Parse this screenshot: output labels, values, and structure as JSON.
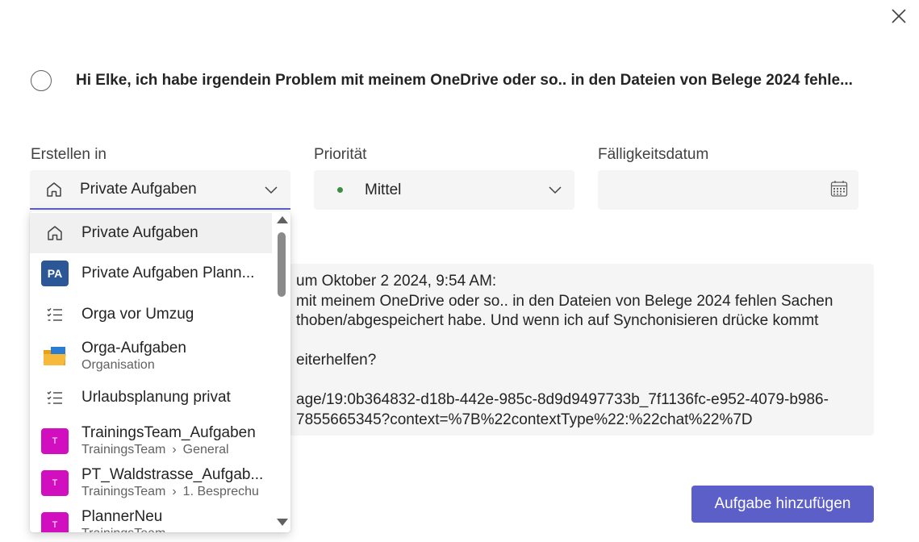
{
  "task": {
    "title": "Hi Elke, ich habe irgendein Problem mit meinem OneDrive oder so.. in den Dateien von Belege 2024 fehle..."
  },
  "fields": {
    "create_in": {
      "label": "Erstellen in",
      "value": "Private Aufgaben"
    },
    "priority": {
      "label": "Priorität",
      "value": "Mittel",
      "color": "#3a8f3e"
    },
    "due_date": {
      "label": "Fälligkeitsdatum",
      "value": ""
    }
  },
  "dropdown": {
    "items": [
      {
        "label": "Private Aufgaben",
        "icon": "home-icon",
        "selected": true
      },
      {
        "label": "Private Aufgaben Plann...",
        "icon": "plan-badge",
        "badge": "PA",
        "badge_color": "#2b5797"
      },
      {
        "label": "Orga vor Umzug",
        "icon": "checklist-icon"
      },
      {
        "label": "Orga-Aufgaben",
        "sub": "Organisation",
        "icon": "folder-icon"
      },
      {
        "label": "Urlaubsplanung privat",
        "icon": "checklist-icon"
      },
      {
        "label": "TrainingsTeam_Aufgaben",
        "sub": "TrainingsTeam",
        "sub2": "General",
        "icon": "team-badge",
        "badge": "T",
        "badge_color": "#d10fbe"
      },
      {
        "label": "PT_Waldstrasse_Aufgab...",
        "sub": "TrainingsTeam",
        "sub2": "1. Besprechu",
        "icon": "team-badge",
        "badge": "T",
        "badge_color": "#d10fbe"
      },
      {
        "label": "PlannerNeu",
        "sub": "TrainingsTeam",
        "icon": "team-badge",
        "badge": "T",
        "badge_color": "#d10fbe"
      }
    ]
  },
  "description": {
    "lines": [
      "um Oktober 2 2024, 9:54 AM:",
      "mit meinem OneDrive oder so.. in den Dateien von Belege 2024 fehlen Sachen",
      "thoben/abgespeichert habe. Und wenn ich auf Synchonisieren drücke kommt",
      "",
      "eiterhelfen?",
      "",
      "age/19:0b364832-d18b-442e-985c-8d9d9497733b_7f1136fc-e952-4079-b986-",
      "7855665345?context=%7B%22contextType%22:%22chat%22%7D"
    ]
  },
  "actions": {
    "add_task": "Aufgabe hinzufügen"
  },
  "colors": {
    "accent": "#5b5fc7"
  }
}
